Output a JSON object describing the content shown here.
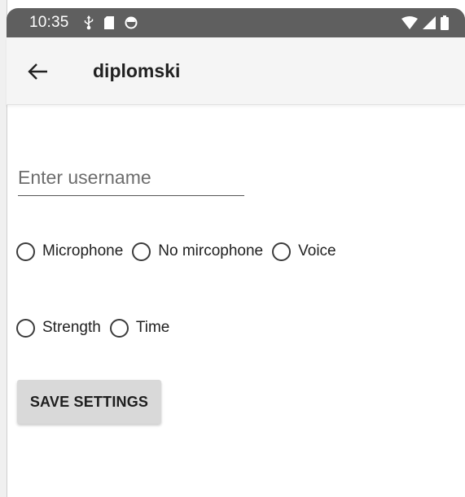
{
  "status_bar": {
    "time": "10:35",
    "left_icons": [
      "usb-icon",
      "sd-card-icon",
      "sync-icon"
    ],
    "right_icons": [
      "wifi-icon",
      "signal-icon",
      "battery-icon"
    ],
    "background": "#5f5f5f"
  },
  "app_bar": {
    "back_icon": "arrow-left-icon",
    "title": "diplomski",
    "background": "#f5f5f5"
  },
  "form": {
    "username": {
      "value": "",
      "placeholder": "Enter username"
    },
    "radio_row_1": [
      {
        "label": "Microphone",
        "checked": false
      },
      {
        "label": "No mircophone",
        "checked": false
      },
      {
        "label": "Voice",
        "checked": false
      }
    ],
    "radio_row_2": [
      {
        "label": "Strength",
        "checked": false
      },
      {
        "label": "Time",
        "checked": false
      }
    ],
    "save_button_label": "SAVE SETTINGS",
    "save_button_color": "#d9d9d9"
  }
}
